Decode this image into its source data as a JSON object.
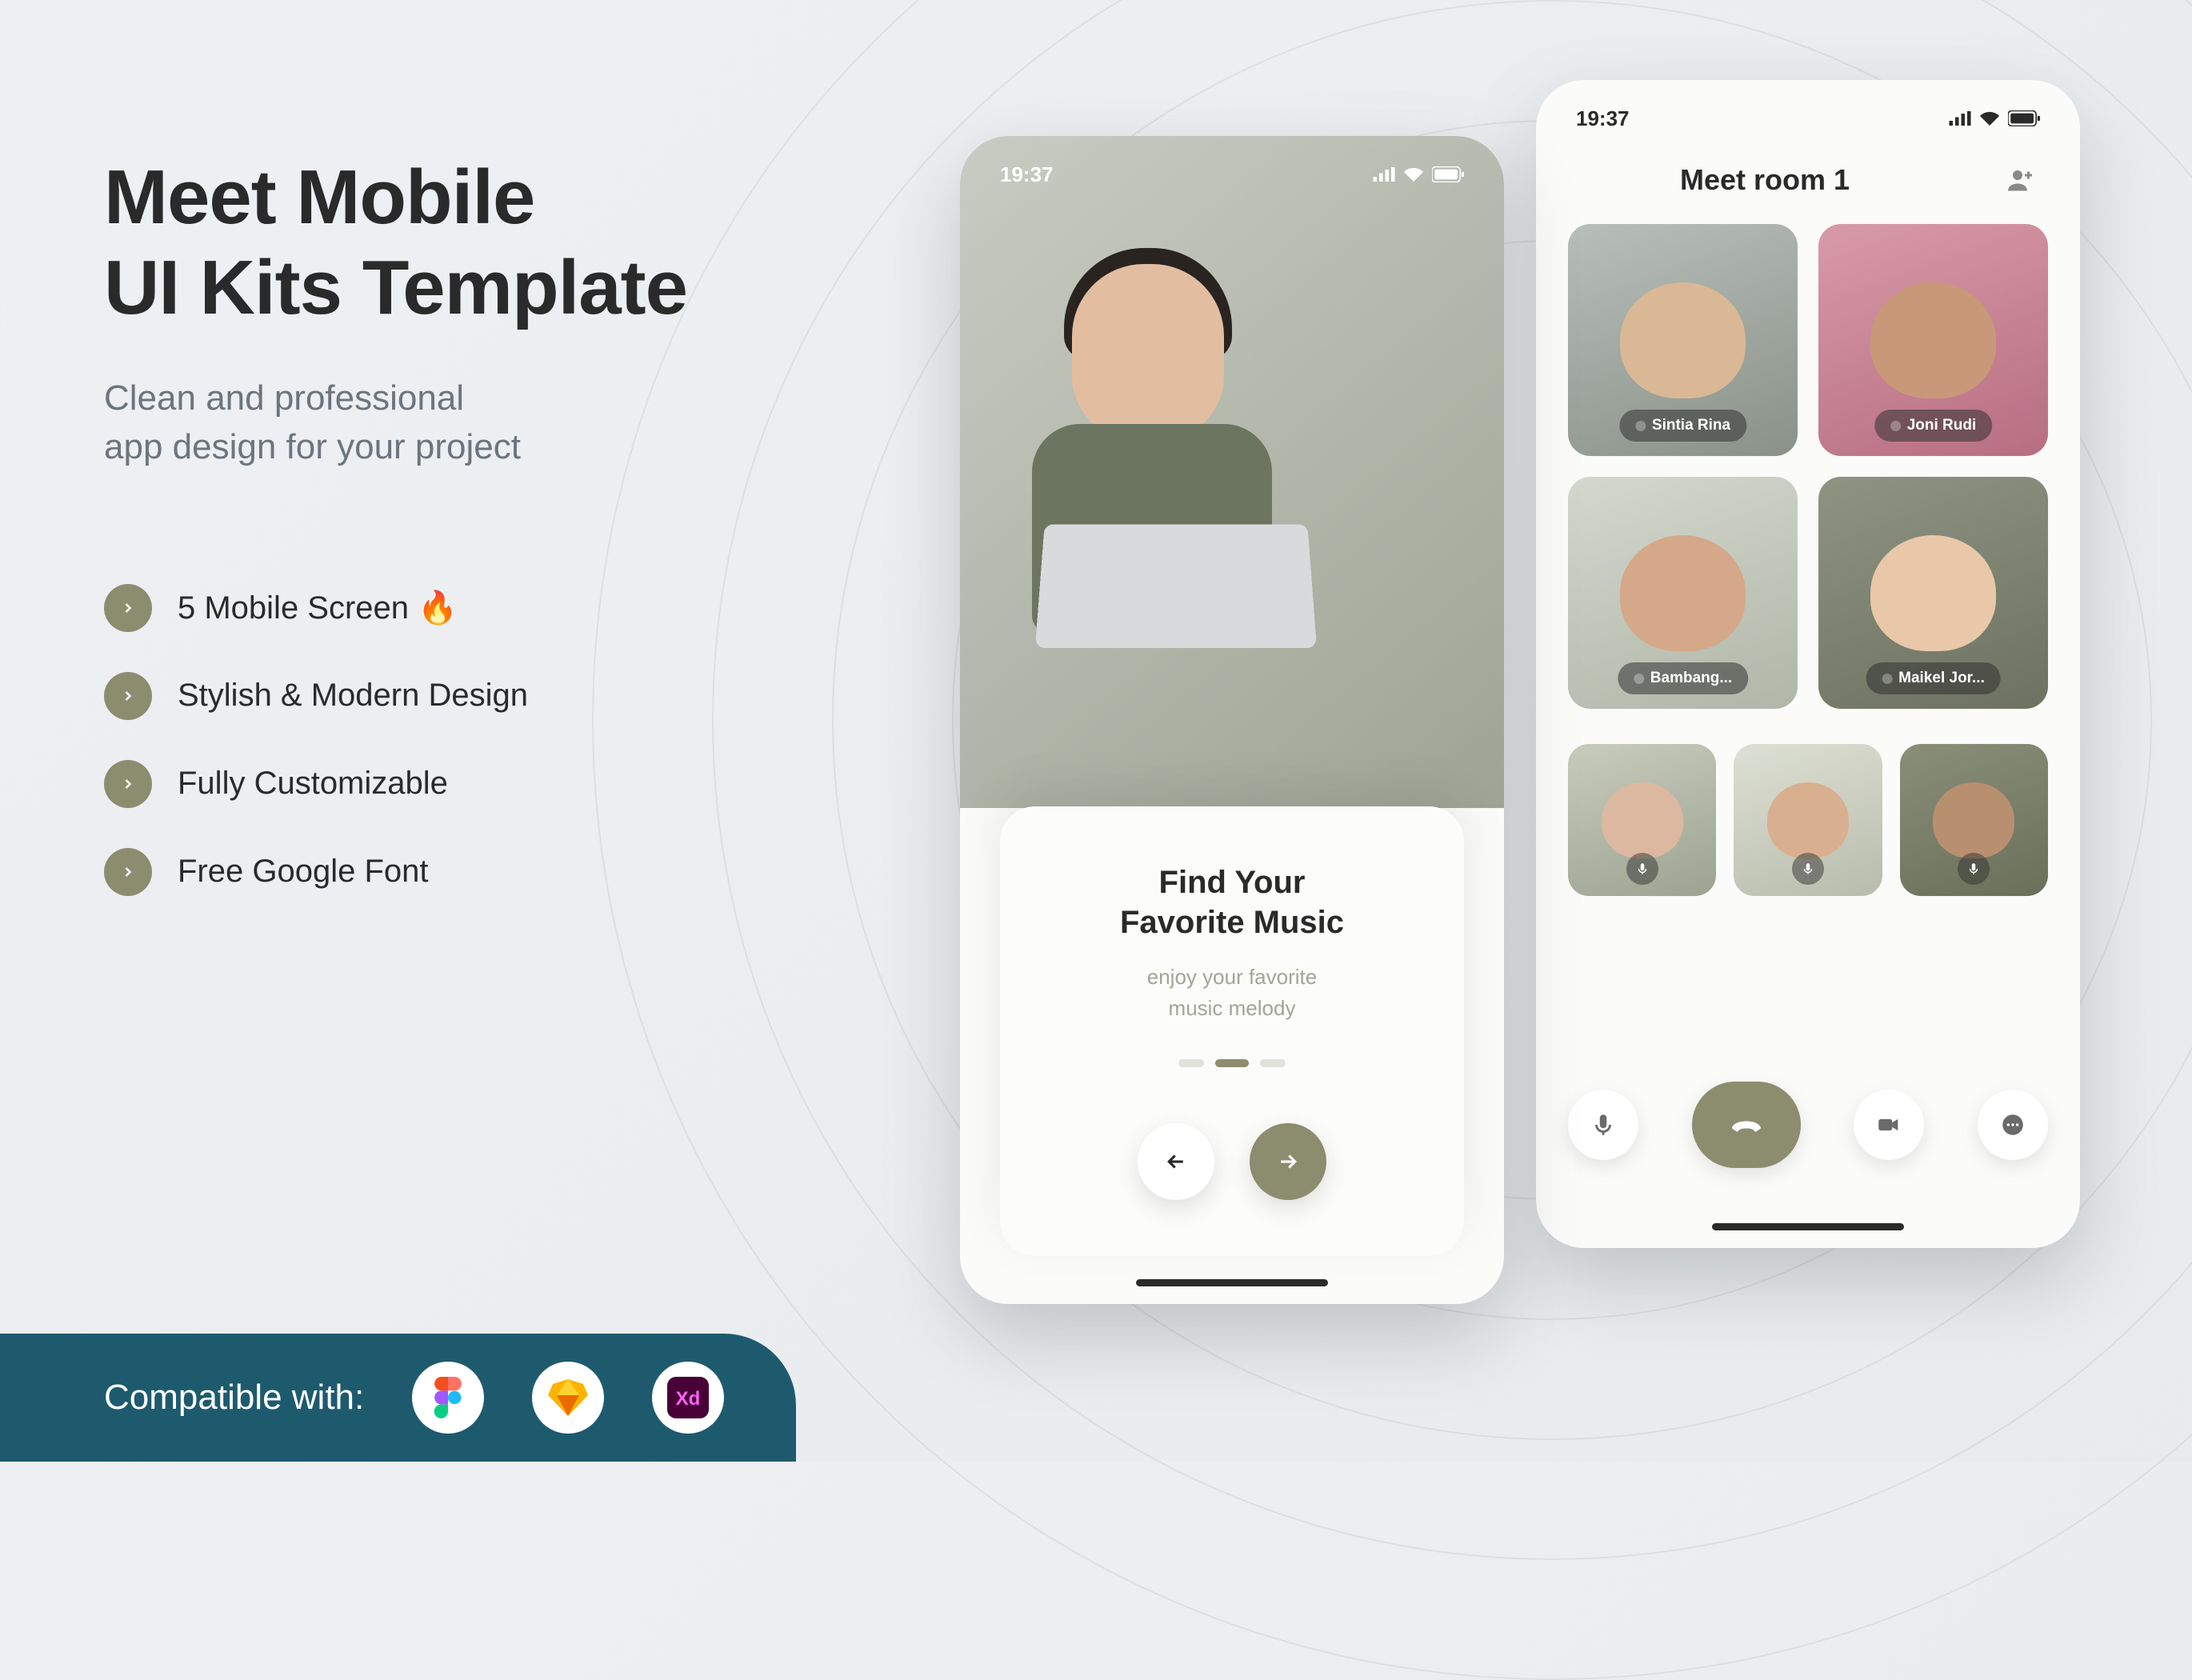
{
  "title_line1": "Meet Mobile",
  "title_line2": "UI Kits Template",
  "subtitle_line1": "Clean and professional",
  "subtitle_line2": "app design for your project",
  "features": [
    "5 Mobile Screen 🔥",
    "Stylish & Modern Design",
    "Fully Customizable",
    "Free Google Font"
  ],
  "footer_label": "Compatible with:",
  "compat_apps": [
    "Figma",
    "Sketch",
    "Adobe XD"
  ],
  "phone1": {
    "time": "19:37",
    "card_title_line1": "Find Your",
    "card_title_line2": "Favorite Music",
    "card_sub_line1": "enjoy your favorite",
    "card_sub_line2": "music melody",
    "page_active_index": 1,
    "page_count": 3
  },
  "phone2": {
    "time": "19:37",
    "room_title": "Meet room 1",
    "participants": [
      {
        "name": "Sintia Rina"
      },
      {
        "name": "Joni Rudi"
      },
      {
        "name": "Bambang..."
      },
      {
        "name": "Maikel Jor..."
      }
    ]
  },
  "colors": {
    "accent": "#8c8d6f",
    "footer": "#1e5a6e",
    "text": "#2a2a2a"
  }
}
